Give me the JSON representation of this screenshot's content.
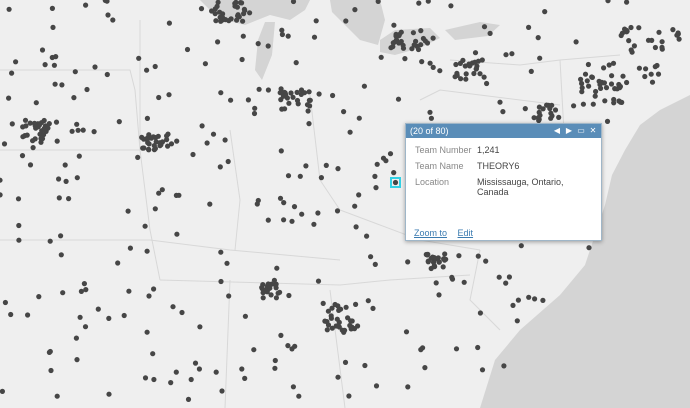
{
  "popup": {
    "counter": "(20 of 80)",
    "prev_icon": "triangle-left-icon",
    "next_icon": "triangle-right-icon",
    "maximize_icon": "maximize-icon",
    "close_icon": "close-icon",
    "fields": [
      {
        "label": "Team Number",
        "value": "1,241"
      },
      {
        "label": "Team Name",
        "value": "THEORY6"
      },
      {
        "label": "Location",
        "value": "Mississauga, Ontario, Canada"
      }
    ],
    "zoom_label": "Zoom to",
    "edit_label": "Edit"
  },
  "colors": {
    "land": "#efefef",
    "water": "#d4d4d4",
    "marker": "#464646",
    "header": "#5a8db8",
    "highlight": "#33d2e6"
  }
}
